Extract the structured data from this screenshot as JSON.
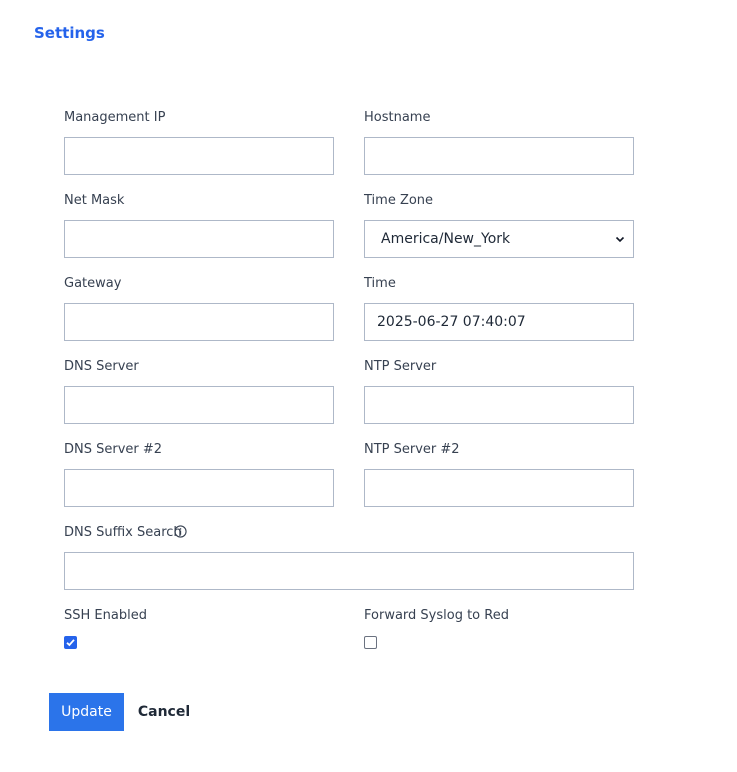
{
  "header": {
    "title": "Settings"
  },
  "form": {
    "management_ip": {
      "label": "Management IP",
      "value": ""
    },
    "hostname": {
      "label": "Hostname",
      "value": ""
    },
    "net_mask": {
      "label": "Net Mask",
      "value": ""
    },
    "time_zone": {
      "label": "Time Zone",
      "value": "America/New_York",
      "icon": "chevron-down-icon"
    },
    "gateway": {
      "label": "Gateway",
      "value": ""
    },
    "time": {
      "label": "Time",
      "value": "2025-06-27 07:40:07"
    },
    "dns_server": {
      "label": "DNS Server",
      "value": ""
    },
    "ntp_server": {
      "label": "NTP Server",
      "value": ""
    },
    "dns_server_2": {
      "label": "DNS Server #2",
      "value": ""
    },
    "ntp_server_2": {
      "label": "NTP Server #2",
      "value": ""
    },
    "dns_suffix_search": {
      "label": "DNS Suffix Search",
      "value": "",
      "icon": "info-icon"
    },
    "ssh_enabled": {
      "label": "SSH Enabled",
      "checked": true
    },
    "forward_syslog": {
      "label": "Forward Syslog to Red",
      "checked": false
    }
  },
  "actions": {
    "update_label": "Update",
    "cancel_label": "Cancel"
  },
  "colors": {
    "accent": "#2563eb",
    "button": "#2b74ea",
    "border": "#aeb8c8"
  }
}
